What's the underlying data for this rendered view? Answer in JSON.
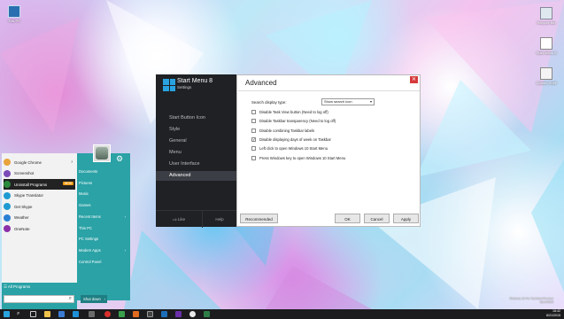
{
  "desktop": {
    "icons": [
      {
        "label": "This PC"
      },
      {
        "label": "Recycle Bin"
      },
      {
        "label": "Start Menu 8"
      },
      {
        "label": "Classic Shell"
      }
    ],
    "watermark": [
      "Windows 10 Pro Technical Preview",
      "Build 9926"
    ]
  },
  "start_menu": {
    "programs": [
      {
        "label": "Google Chrome",
        "color": "#e8a33c",
        "arrow": true
      },
      {
        "label": "Screenshot",
        "color": "#7c4ab8"
      },
      {
        "label": "Uninstall Programs",
        "color": "#2b8a3e",
        "badge": "NEW",
        "highlighted": true
      },
      {
        "label": "Skype Translator",
        "color": "#1d9bd1"
      },
      {
        "label": "Get Skype",
        "color": "#1d9bd1"
      },
      {
        "label": "Weather",
        "color": "#2a7fd4"
      },
      {
        "label": "OneNote",
        "color": "#8a2fa8"
      }
    ],
    "links": [
      {
        "label": "Documents"
      },
      {
        "label": "Pictures"
      },
      {
        "label": "Music"
      },
      {
        "label": "Games"
      },
      {
        "label": "Recent Items",
        "arrow": true
      },
      {
        "label": "This PC"
      },
      {
        "label": "PC Settings"
      },
      {
        "label": "Modern Apps",
        "arrow": true
      },
      {
        "label": "Control Panel"
      }
    ],
    "all_programs": "All Programs",
    "search_placeholder": "",
    "shutdown": "Shut down"
  },
  "settings_window": {
    "app_title": "Start Menu 8",
    "app_subtitle": "Settings",
    "nav": [
      {
        "label": "Start Button Icon"
      },
      {
        "label": "Style"
      },
      {
        "label": "General"
      },
      {
        "label": "Menu"
      },
      {
        "label": "User Interface"
      },
      {
        "label": "Advanced",
        "active": true
      }
    ],
    "like": "Like",
    "help": "Help",
    "page_title": "Advanced",
    "search_display_label": "Search display type:",
    "search_display_value": "Show search icon",
    "options": [
      {
        "label": "Disable Task View button (Need to log off)",
        "checked": false
      },
      {
        "label": "Disable Taskbar transparency (Need to log off)",
        "checked": false
      },
      {
        "label": "Disable combining Taskbar labels",
        "checked": false
      },
      {
        "label": "Disable displaying days of week on Taskbar",
        "checked": true
      },
      {
        "label": "Left click to open Windows 10 Start Menu",
        "checked": false
      },
      {
        "label": "Press Windows key to open Windows 10 Start Menu",
        "checked": false
      }
    ],
    "buttons": {
      "recommended": "Recommended",
      "ok": "OK",
      "cancel": "Cancel",
      "apply": "Apply"
    }
  },
  "taskbar": {
    "time": "18:42",
    "date": "8/21/2015"
  }
}
